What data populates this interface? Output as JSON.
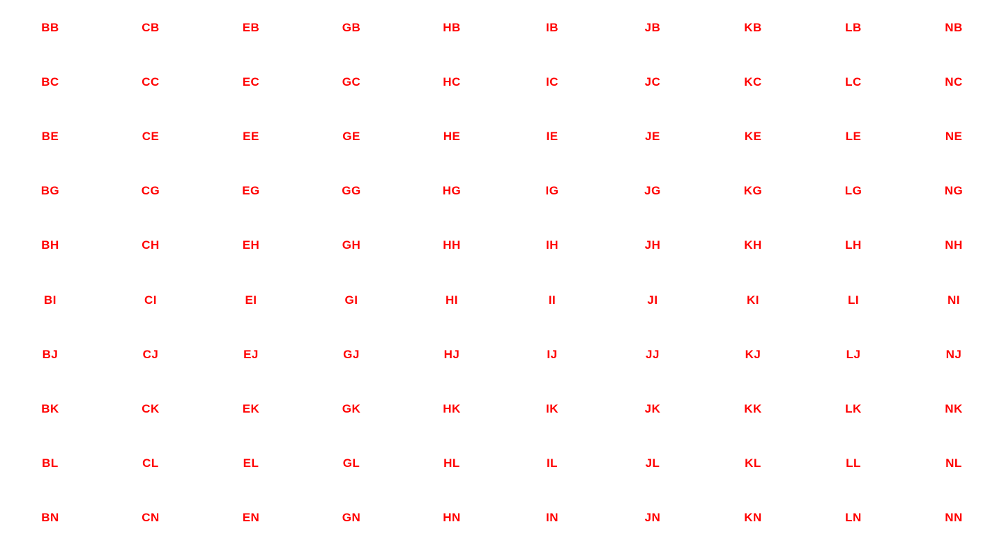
{
  "text_color": "#ff0000",
  "grid": {
    "rows": [
      [
        "BB",
        "CB",
        "EB",
        "GB",
        "HB",
        "IB",
        "JB",
        "KB",
        "LB",
        "NB"
      ],
      [
        "BC",
        "CC",
        "EC",
        "GC",
        "HC",
        "IC",
        "JC",
        "KC",
        "LC",
        "NC"
      ],
      [
        "BE",
        "CE",
        "EE",
        "GE",
        "HE",
        "IE",
        "JE",
        "KE",
        "LE",
        "NE"
      ],
      [
        "BG",
        "CG",
        "EG",
        "GG",
        "HG",
        "IG",
        "JG",
        "KG",
        "LG",
        "NG"
      ],
      [
        "BH",
        "CH",
        "EH",
        "GH",
        "HH",
        "IH",
        "JH",
        "KH",
        "LH",
        "NH"
      ],
      [
        "BI",
        "CI",
        "EI",
        "GI",
        "HI",
        "II",
        "JI",
        "KI",
        "LI",
        "NI"
      ],
      [
        "BJ",
        "CJ",
        "EJ",
        "GJ",
        "HJ",
        "IJ",
        "JJ",
        "KJ",
        "LJ",
        "NJ"
      ],
      [
        "BK",
        "CK",
        "EK",
        "GK",
        "HK",
        "IK",
        "JK",
        "KK",
        "LK",
        "NK"
      ],
      [
        "BL",
        "CL",
        "EL",
        "GL",
        "HL",
        "IL",
        "JL",
        "KL",
        "LL",
        "NL"
      ],
      [
        "BN",
        "CN",
        "EN",
        "GN",
        "HN",
        "IN",
        "JN",
        "KN",
        "LN",
        "NN"
      ]
    ]
  }
}
